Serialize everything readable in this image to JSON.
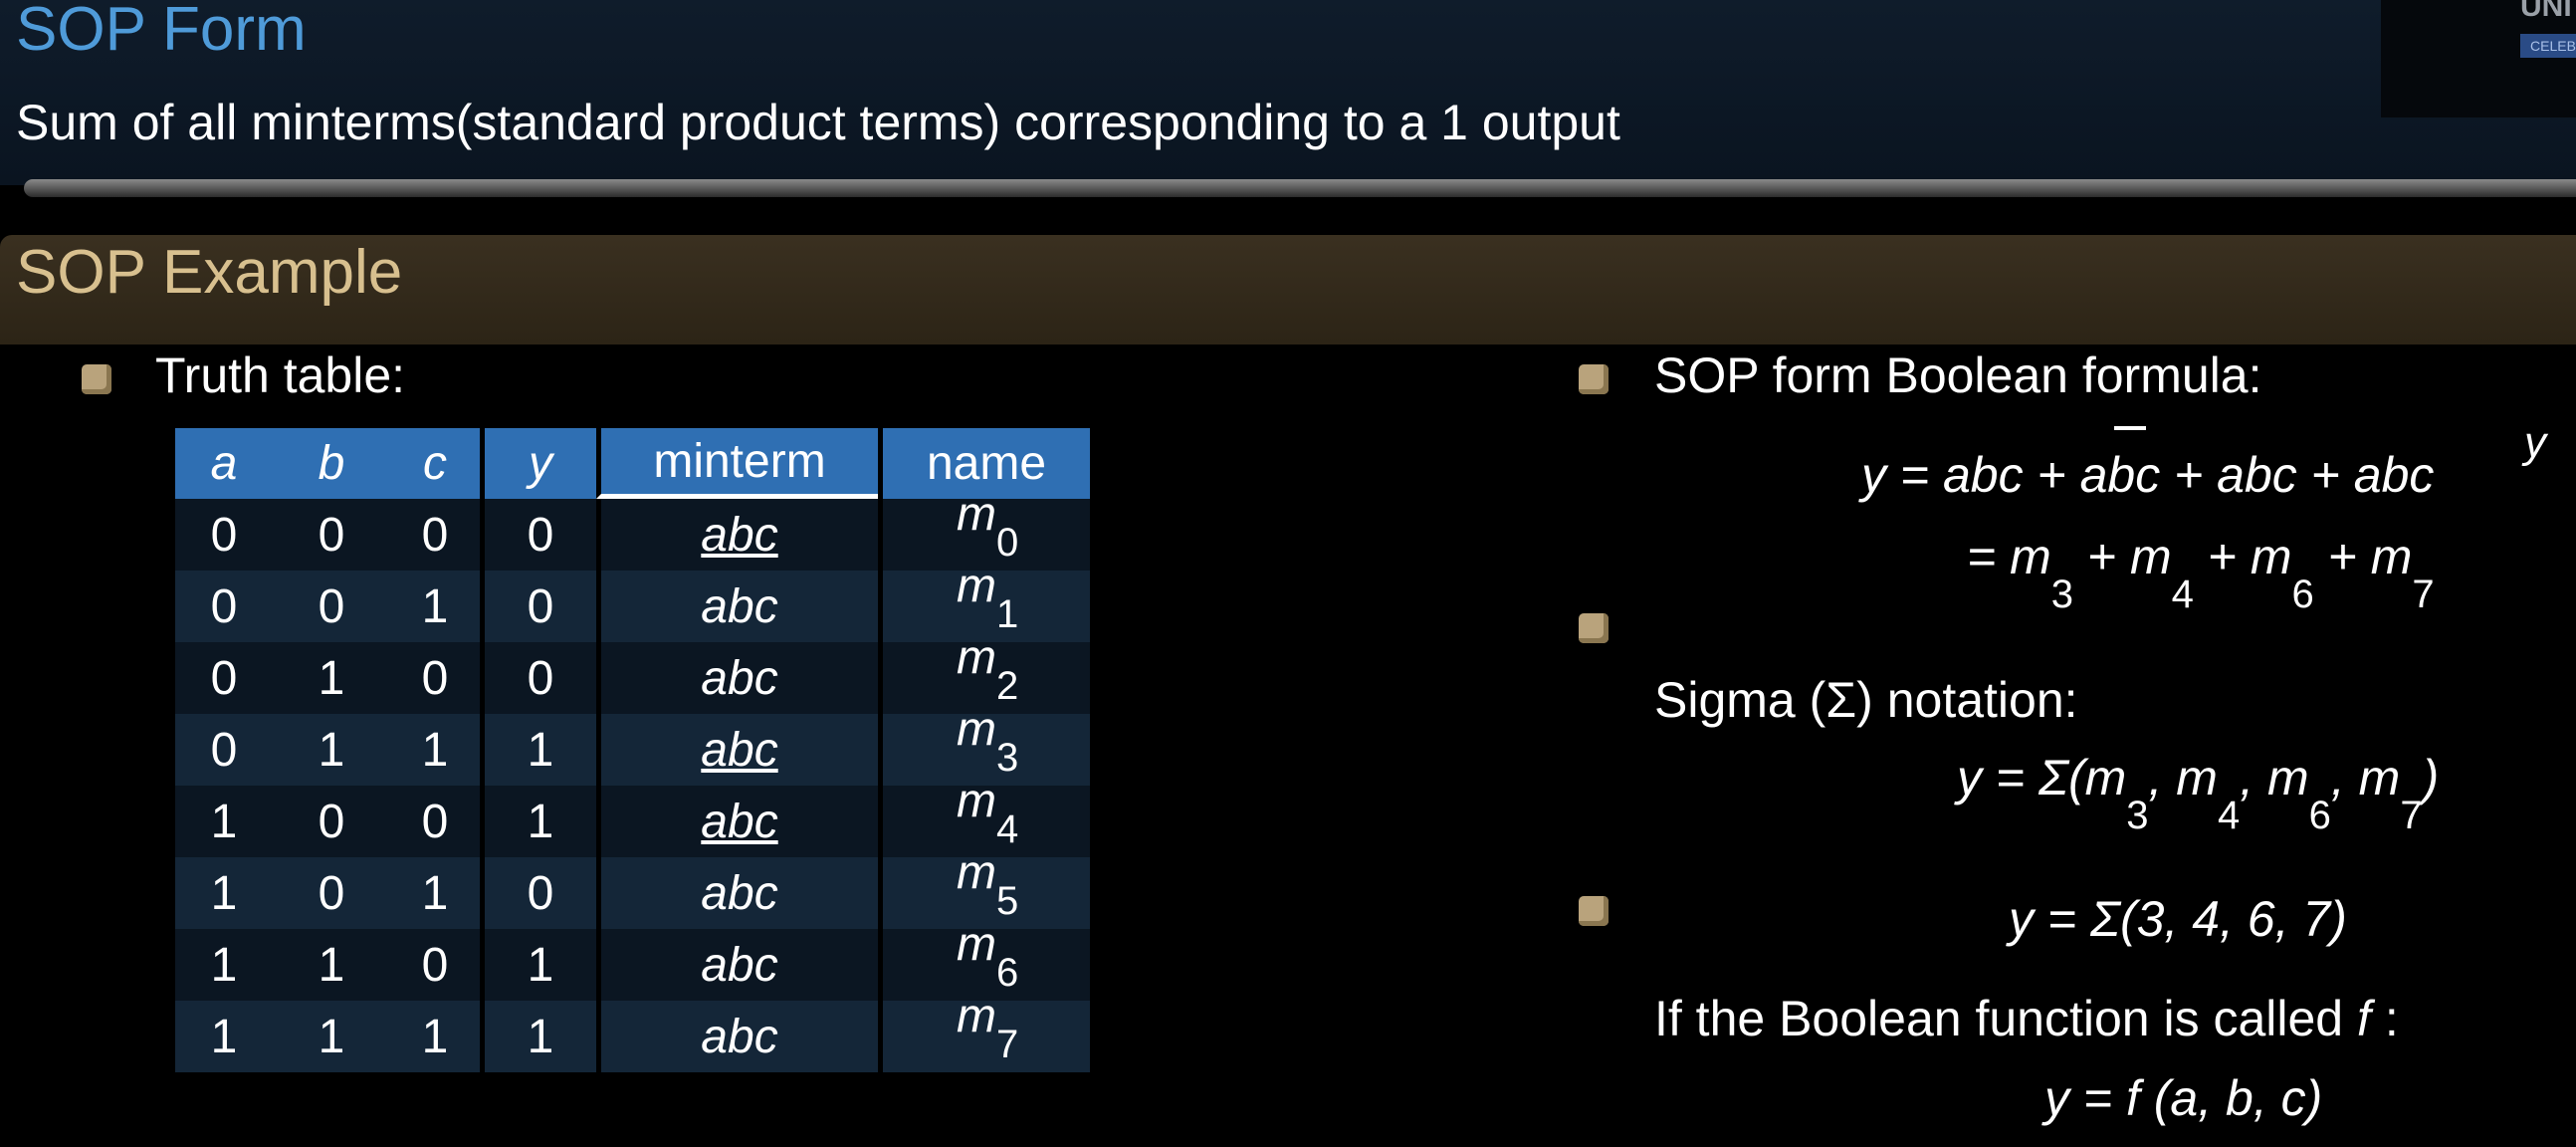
{
  "slide1": {
    "title": "SOP Form",
    "subtitle": "Sum of all minterms(standard product terms) corresponding to a 1 output",
    "logo_text": "UNI",
    "logo_ribbon": "CELEB"
  },
  "slide2": {
    "title": "SOP Example",
    "truth_label": "Truth table:",
    "table": {
      "headers": [
        "a",
        "b",
        "c",
        "y",
        "minterm",
        "name"
      ],
      "rows": [
        [
          "0",
          "0",
          "0",
          "0",
          "abc",
          "m",
          "0"
        ],
        [
          "0",
          "0",
          "1",
          "0",
          "abc",
          "m",
          "1"
        ],
        [
          "0",
          "1",
          "0",
          "0",
          "abc",
          "m",
          "2"
        ],
        [
          "0",
          "1",
          "1",
          "1",
          "abc",
          "m",
          "3"
        ],
        [
          "1",
          "0",
          "0",
          "1",
          "abc",
          "m",
          "4"
        ],
        [
          "1",
          "0",
          "1",
          "0",
          "abc",
          "m",
          "5"
        ],
        [
          "1",
          "1",
          "0",
          "1",
          "abc",
          "m",
          "6"
        ],
        [
          "1",
          "1",
          "1",
          "1",
          "abc",
          "m",
          "7"
        ]
      ]
    },
    "sop_label": "SOP form Boolean formula:",
    "eq1": "y = abc + abc + abc + abc",
    "eq1_side": "y",
    "eq2_prefix": "= m",
    "eq2_terms": [
      "3",
      "4",
      "6",
      "7"
    ],
    "sigma_label": "Sigma (Σ) notation:",
    "eq3_prefix": "y = Σ(m",
    "eq4": "y = Σ(3, 4, 6, 7)",
    "func_label_pre": "If the Boolean function is called ",
    "func_label_f": "f",
    "func_label_post": " :",
    "eq5": "y = f (a, b, c)"
  }
}
